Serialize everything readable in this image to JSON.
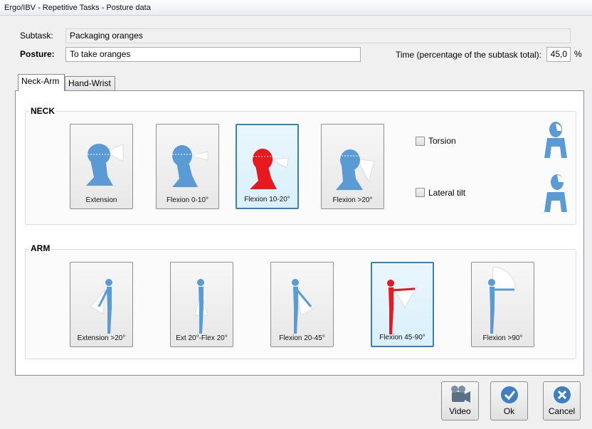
{
  "window": {
    "title": "Ergo/IBV - Repetitive Tasks - Posture data"
  },
  "form": {
    "subtask_label": "Subtask:",
    "subtask_value": "Packaging oranges",
    "posture_label": "Posture:",
    "posture_value": "To take oranges",
    "time_label": "Time (percentage of the subtask total):",
    "time_value": "45,0",
    "time_unit": "%"
  },
  "tabs": [
    {
      "label": "Neck-Arm",
      "active": true
    },
    {
      "label": "Hand-Wrist",
      "active": false
    }
  ],
  "neck": {
    "title": "NECK",
    "postures": [
      {
        "label": "Extension",
        "selected": false
      },
      {
        "label": "Flexion 0-10°",
        "selected": false
      },
      {
        "label": "Flexion 10-20°",
        "selected": true
      },
      {
        "label": "Flexion >20°",
        "selected": false
      }
    ],
    "options": [
      {
        "label": "Torsion",
        "checked": false,
        "icon": "torso-torsion-icon"
      },
      {
        "label": "Lateral tilt",
        "checked": false,
        "icon": "torso-lateral-tilt-icon"
      }
    ]
  },
  "arm": {
    "title": "ARM",
    "postures": [
      {
        "label": "Extension >20°",
        "selected": false
      },
      {
        "label": "Ext 20°-Flex 20°",
        "selected": false
      },
      {
        "label": "Flexion 20-45°",
        "selected": false
      },
      {
        "label": "Flexion 45-90°",
        "selected": true
      },
      {
        "label": "Flexion >90°",
        "selected": false
      }
    ]
  },
  "actions": [
    {
      "label": "Video",
      "icon": "video-camera-icon"
    },
    {
      "label": "Ok",
      "icon": "check-icon"
    },
    {
      "label": "Cancel",
      "icon": "cancel-icon"
    }
  ],
  "colors": {
    "figure_blue": "#5b9bd5",
    "selected_red": "#e8191e",
    "selection_border": "#3c7fb1"
  }
}
